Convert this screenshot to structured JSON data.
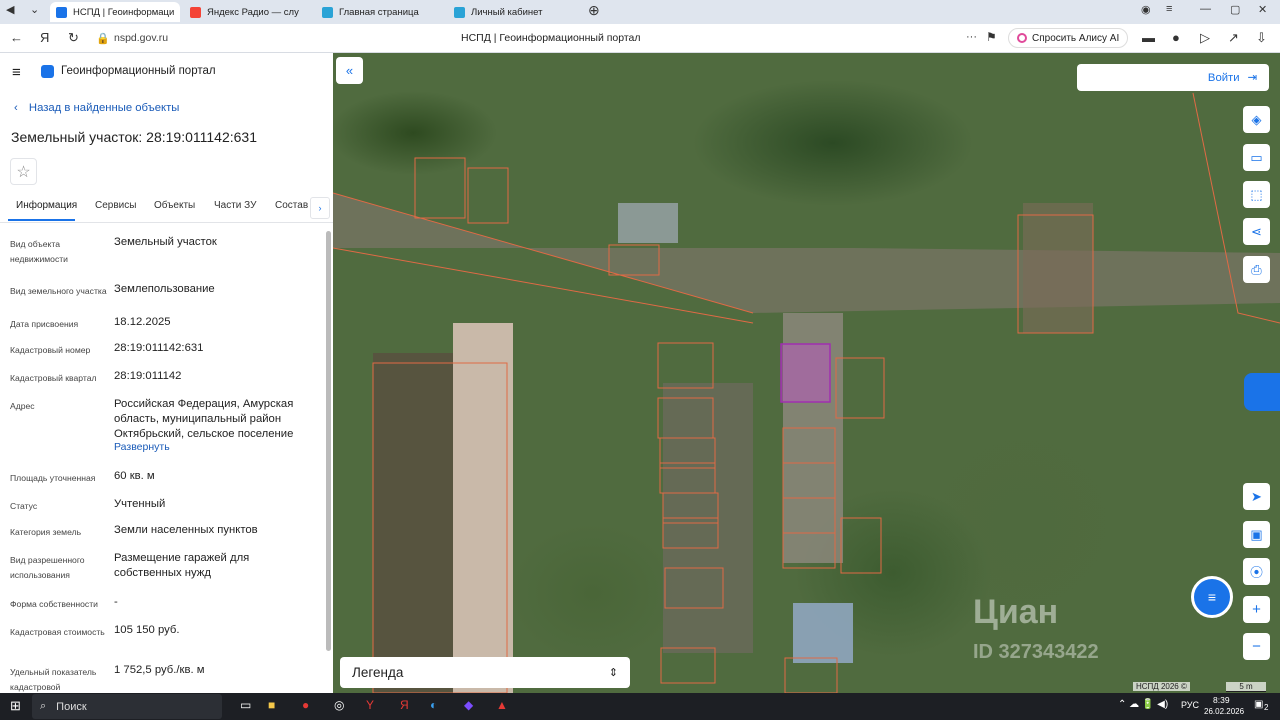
{
  "tabs": [
    {
      "label": "НСПД | Геоинформаци",
      "color": "#1a73e8",
      "active": true
    },
    {
      "label": "Яндекс Радио — слу",
      "color": "#f44336",
      "active": false
    },
    {
      "label": "Главная страница",
      "color": "#2aa3d6",
      "active": false
    },
    {
      "label": "Личный кабинет",
      "color": "#2aa3d6",
      "active": false
    }
  ],
  "address": {
    "url": "nspd.gov.ru",
    "title": "НСПД | Геоинформационный портал",
    "alice": "Спросить Алису AI"
  },
  "panel": {
    "portal_name": "Геоинформационный портал",
    "back_link": "Назад в найденные объекты",
    "title": "Земельный участок: 28:19:011142:631",
    "tabs": [
      "Информация",
      "Сервисы",
      "Объекты",
      "Части ЗУ",
      "Состав"
    ],
    "fields": [
      {
        "label": "Вид объекта недвижимости",
        "value": "Земельный участок"
      },
      {
        "label": "Вид земельного участка",
        "value": "Землепользование"
      },
      {
        "label": "Дата присвоения",
        "value": "18.12.2025"
      },
      {
        "label": "Кадастровый номер",
        "value": "28:19:011142:631"
      },
      {
        "label": "Кадастровый квартал",
        "value": "28:19:011142"
      },
      {
        "label": "Адрес",
        "value": "Российская Федерация, Амурская область, муниципальный район Октябрьский, сельское поселение"
      },
      {
        "label": "Площадь уточненная",
        "value": "60 кв. м"
      },
      {
        "label": "Статус",
        "value": "Учтенный"
      },
      {
        "label": "Категория земель",
        "value": "Земли населенных пунктов"
      },
      {
        "label": "Вид разрешенного использования",
        "value": "Размещение гаражей для собственных нужд"
      },
      {
        "label": "Форма собственности",
        "value": "-"
      },
      {
        "label": "Кадастровая стоимость",
        "value": "105 150 руб."
      },
      {
        "label": "Удельный показатель кадастровой",
        "value": "1 752,5 руб./кв. м"
      }
    ],
    "expand_link": "Развернуть"
  },
  "map": {
    "login": "Войти",
    "legend": "Легенда",
    "watermark": "Циан",
    "watermark_id": "ID 327343422",
    "copyright": "НСПД 2026 ©",
    "scale": "5 m"
  },
  "taskbar": {
    "search": "Поиск",
    "lang": "РУС",
    "time": "8:39",
    "date": "26.02.2026",
    "notif": "2"
  },
  "colors": {
    "accent": "#1a73e8",
    "parcel": "#c64fd1",
    "boundary": "#e06a45"
  }
}
